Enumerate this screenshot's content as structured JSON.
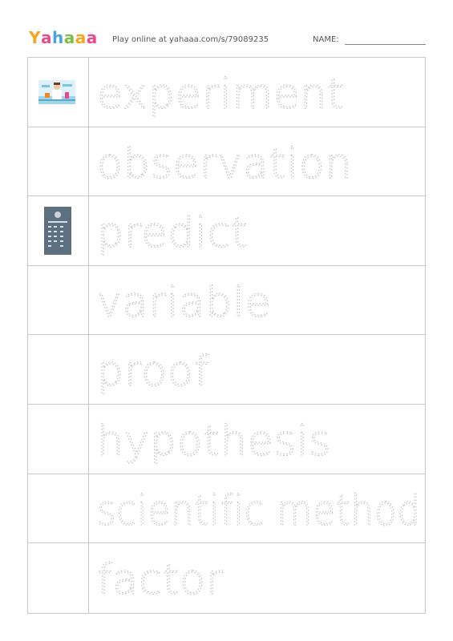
{
  "header": {
    "logo_letters": [
      "Y",
      "a",
      "h",
      "a",
      "a",
      "a"
    ],
    "logo_colors": [
      "#f5a623",
      "#e94b8a",
      "#4aa3df",
      "#7ac143",
      "#f5a623",
      "#e94b8a"
    ],
    "play_text": "Play online at yahaaa.com/s/79089235",
    "name_label": "NAME:"
  },
  "rows": [
    {
      "word": "experiment",
      "picture": "scientist-lab-picture"
    },
    {
      "word": "observation",
      "picture": ""
    },
    {
      "word": "predict",
      "picture": "weather-forecast-picture"
    },
    {
      "word": "variable",
      "picture": ""
    },
    {
      "word": "proof",
      "picture": ""
    },
    {
      "word": "hypothesis",
      "picture": ""
    },
    {
      "word": "scientific method",
      "picture": ""
    },
    {
      "word": "factor",
      "picture": ""
    }
  ]
}
